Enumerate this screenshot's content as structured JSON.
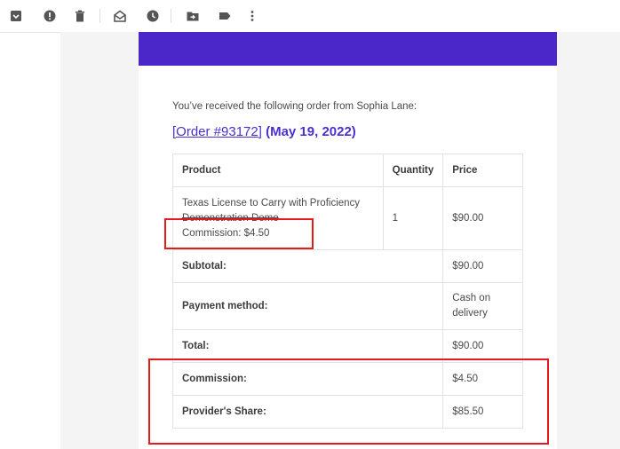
{
  "toolbar": {
    "icons": [
      "archive-icon",
      "report-spam-icon",
      "delete-icon",
      "mark-unread-icon",
      "snooze-icon",
      "move-to-icon",
      "label-icon",
      "more-vert-icon"
    ]
  },
  "email": {
    "intro": "You’ve received the following order from Sophia Lane:",
    "order_link": "[Order #93172]",
    "order_date": "(May 19, 2022)",
    "table": {
      "headers": {
        "product": "Product",
        "quantity": "Quantity",
        "price": "Price"
      },
      "item": {
        "product_line1": "Texas License to Carry with Proficiency",
        "product_line2": "Demonstration Demo",
        "commission_line": "Commission: $4.50",
        "quantity": "1",
        "price": "$90.00"
      },
      "subtotal": {
        "label": "Subtotal:",
        "value": "$90.00"
      },
      "payment": {
        "label": "Payment method:",
        "value": "Cash on delivery"
      },
      "total": {
        "label": "Total:",
        "value": "$90.00"
      },
      "commission": {
        "label": "Commission:",
        "value": "$4.50"
      },
      "provider_share": {
        "label": "Provider's Share:",
        "value": "$85.50"
      }
    }
  },
  "colors": {
    "banner": "#4b26c9",
    "link": "#4b2fd1",
    "highlight": "#e51b1b"
  }
}
